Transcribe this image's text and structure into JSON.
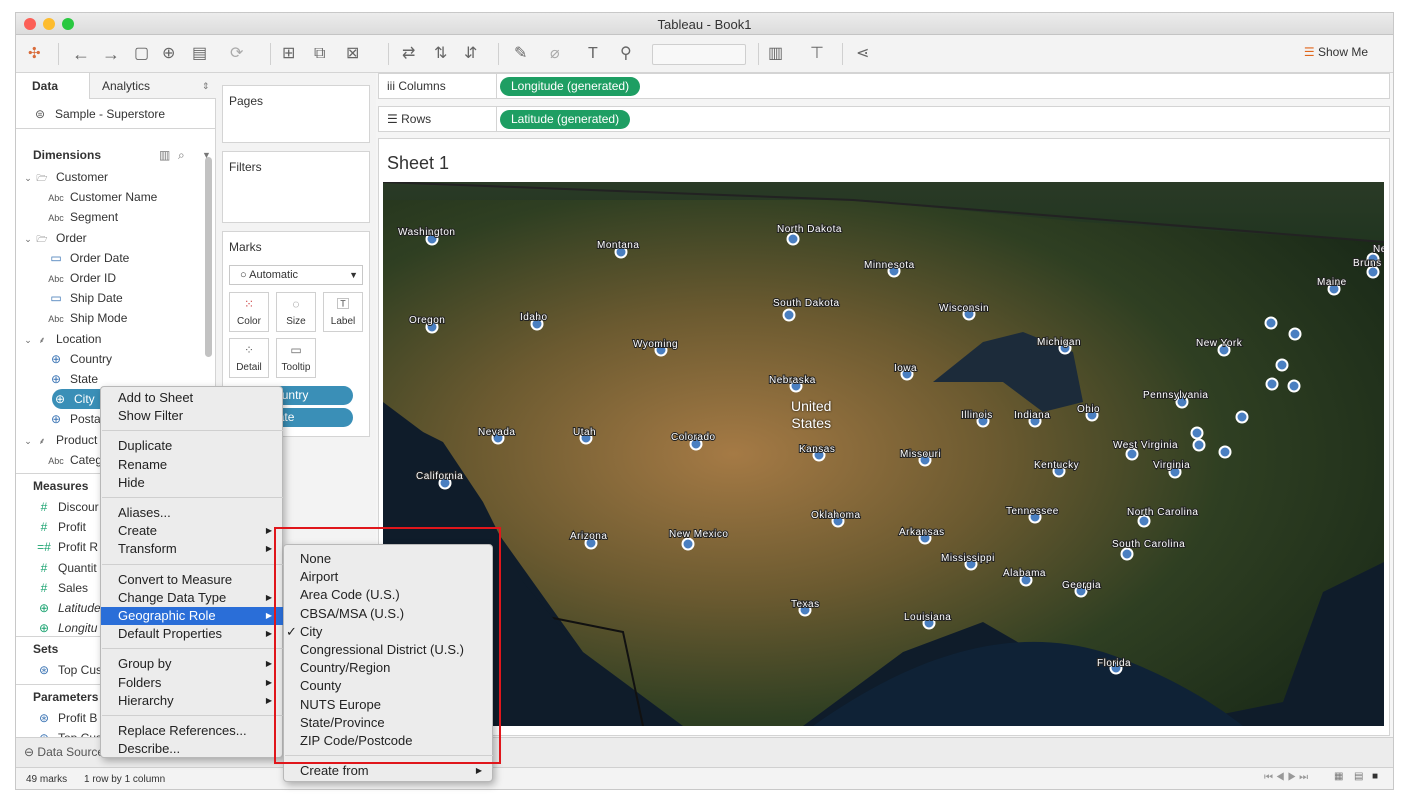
{
  "window": {
    "title": "Tableau - Book1",
    "traffic_lights": [
      "#fc5f57",
      "#fdbc2e",
      "#29c840"
    ]
  },
  "toolbar": {
    "icons": [
      "tableau-logo-icon",
      "undo-icon",
      "redo-icon",
      "save-icon",
      "new-datasource-icon",
      "pause-updates-icon",
      "run-update-icon",
      "new-worksheet-icon",
      "duplicate-sheet-icon",
      "clear-sheet-icon",
      "swap-icon",
      "sort-ascending-icon",
      "sort-descending-icon",
      "highlight-icon",
      "group-icon",
      "show-mark-labels-icon",
      "fix-axes-icon",
      "fit-dropdown",
      "show-cards-icon",
      "presentation-icon",
      "share-icon"
    ],
    "show_me_label": "Show Me"
  },
  "data_pane": {
    "tab_data": "Data",
    "tab_analytics": "Analytics",
    "datasource": "Sample - Superstore",
    "dimensions_header": "Dimensions",
    "dimensions": [
      {
        "label": "Customer",
        "type": "folder",
        "level": 0
      },
      {
        "label": "Customer Name",
        "type": "abc",
        "level": 1
      },
      {
        "label": "Segment",
        "type": "abc",
        "level": 1
      },
      {
        "label": "Order",
        "type": "folder",
        "level": 0
      },
      {
        "label": "Order Date",
        "type": "date",
        "level": 1
      },
      {
        "label": "Order ID",
        "type": "abc",
        "level": 1
      },
      {
        "label": "Ship Date",
        "type": "date",
        "level": 1
      },
      {
        "label": "Ship Mode",
        "type": "abc",
        "level": 1
      },
      {
        "label": "Location",
        "type": "hierarchy",
        "level": 0
      },
      {
        "label": "Country",
        "type": "geo",
        "level": 1
      },
      {
        "label": "State",
        "type": "geo",
        "level": 1
      },
      {
        "label": "City",
        "type": "geo",
        "level": 1,
        "selected": true
      },
      {
        "label": "Posta",
        "type": "geo",
        "level": 1
      },
      {
        "label": "Product",
        "type": "hierarchy",
        "level": 0
      },
      {
        "label": "Categ",
        "type": "abc",
        "level": 1
      }
    ],
    "measures_header": "Measures",
    "measures": [
      {
        "label": "Discour",
        "type": "num"
      },
      {
        "label": "Profit",
        "type": "num"
      },
      {
        "label": "Profit R",
        "type": "calc"
      },
      {
        "label": "Quantit",
        "type": "num"
      },
      {
        "label": "Sales",
        "type": "num"
      },
      {
        "label": "Latitude",
        "type": "geo-measure",
        "italic": true
      },
      {
        "label": "Longitu",
        "type": "geo-measure",
        "italic": true
      }
    ],
    "sets_header": "Sets",
    "sets": [
      {
        "label": "Top Cus"
      }
    ],
    "parameters_header": "Parameters",
    "parameters": [
      {
        "label": "Profit B"
      },
      {
        "label": "Top Cus"
      }
    ]
  },
  "cards": {
    "pages": "Pages",
    "filters": "Filters",
    "marks": "Marks",
    "mark_type": "Automatic",
    "mark_buttons": [
      "Color",
      "Size",
      "Label",
      "Detail",
      "Tooltip"
    ],
    "mark_pills": [
      "Country",
      "State"
    ]
  },
  "shelves": {
    "columns_label": "Columns",
    "columns_pill": "Longitude (generated)",
    "rows_label": "Rows",
    "rows_pill": "Latitude (generated)"
  },
  "sheet": {
    "title": "Sheet 1",
    "country_label": [
      "United",
      "States"
    ],
    "state_labels": [
      "Washington",
      "Montana",
      "North Dakota",
      "Minnesota",
      "Ne",
      "Bruns",
      "Maine",
      "South Dakota",
      "Wisconsin",
      "Oregon",
      "Idaho",
      "Wyoming",
      "Michigan",
      "New York",
      "Iowa",
      "Nebraska",
      "Pennsylvania",
      "Illinois",
      "Indiana",
      "Ohio",
      "Nevada",
      "Utah",
      "Colorado",
      "Kansas",
      "Missouri",
      "West Virginia",
      "Virginia",
      "Kentucky",
      "California",
      "Oklahoma",
      "Tennessee",
      "North Carolina",
      "Arizona",
      "New Mexico",
      "Arkansas",
      "South Carolina",
      "Mississippi",
      "Alabama",
      "Georgia",
      "Texas",
      "Louisiana",
      "Florida"
    ]
  },
  "status": {
    "tab_label": "Data Source",
    "marks": "49 marks",
    "dims": "1 row by 1 column"
  },
  "context_menu": {
    "groups": [
      [
        "Add to Sheet",
        "Show Filter"
      ],
      [
        "Duplicate",
        "Rename",
        "Hide"
      ],
      [
        "Aliases...",
        "Create",
        "Transform"
      ],
      [
        "Convert to Measure",
        "Change Data Type",
        "Geographic Role",
        "Default Properties"
      ],
      [
        "Group by",
        "Folders",
        "Hierarchy"
      ],
      [
        "Replace References...",
        "Describe..."
      ]
    ],
    "submenu_items": [
      "Create",
      "Transform",
      "Change Data Type",
      "Geographic Role",
      "Default Properties",
      "Group by",
      "Folders",
      "Hierarchy"
    ],
    "highlighted": "Geographic Role"
  },
  "geo_submenu": {
    "items": [
      "None",
      "Airport",
      "Area Code (U.S.)",
      "CBSA/MSA (U.S.)",
      "City",
      "Congressional District (U.S.)",
      "Country/Region",
      "County",
      "NUTS Europe",
      "State/Province",
      "ZIP Code/Postcode"
    ],
    "checked": "City",
    "create_from": "Create from"
  },
  "colors": {
    "pill_green": "#1e9e63",
    "pill_blue": "#3a8fb7",
    "menu_highlight": "#2a6ed8",
    "annotation_red": "#e0161b",
    "mark_fill": "#4a7fc1"
  }
}
